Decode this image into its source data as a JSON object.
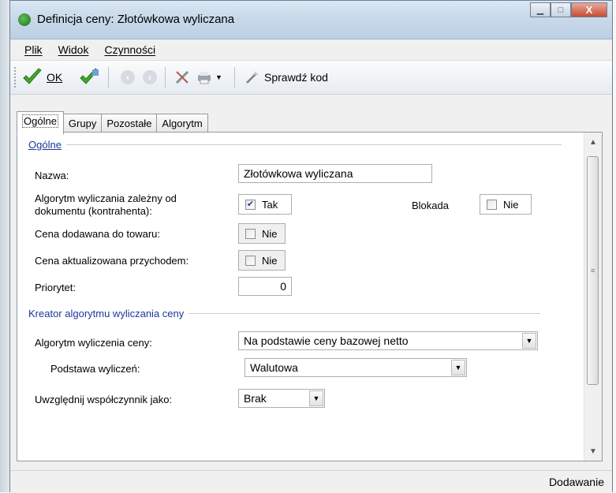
{
  "window": {
    "title": "Definicja ceny: Złotówkowa wyliczana",
    "minimize": "▁",
    "maximize": "□",
    "close": "X"
  },
  "menu": {
    "items": [
      "Plik",
      "Widok",
      "Czynności"
    ]
  },
  "toolbar": {
    "ok_label": "OK",
    "check_label": "Sprawdź kod",
    "back_glyph": "‹",
    "forward_glyph": "›",
    "dropdown_glyph": "▼"
  },
  "tabs": [
    "Ogólne",
    "Grupy",
    "Pozostałe",
    "Algorytm"
  ],
  "general": {
    "section_title": "Ogólne",
    "name_label": "Nazwa:",
    "name_value": "Złotówkowa wyliczana",
    "algo_dependent_label_1": "Algorytm wyliczania zależny od",
    "algo_dependent_label_2": "dokumentu (kontrahenta):",
    "algo_dependent_value": "Tak",
    "algo_dependent_checked": true,
    "lock_label": "Blokada",
    "lock_value": "Nie",
    "lock_checked": false,
    "added_price_label": "Cena dodawana do towaru:",
    "added_price_value": "Nie",
    "updated_price_label": "Cena aktualizowana przychodem:",
    "updated_price_value": "Nie",
    "priority_label": "Priorytet:",
    "priority_value": "0"
  },
  "wizard": {
    "section_title": "Kreator algorytmu wyliczania ceny",
    "algo_label": "Algorytm wyliczenia ceny:",
    "algo_value": "Na podstawie ceny bazowej netto",
    "basis_label": "Podstawa wyliczeń:",
    "basis_value": "Walutowa",
    "coef_label": "Uwzględnij współczynnik jako:",
    "coef_value": "Brak"
  },
  "scrollbar": {
    "up": "▲",
    "down": "▼",
    "grip": "≡"
  },
  "status": {
    "mode": "Dodawanie"
  },
  "colors": {
    "section_heading": "#1b3a99",
    "ok_green": "#43a52f"
  }
}
